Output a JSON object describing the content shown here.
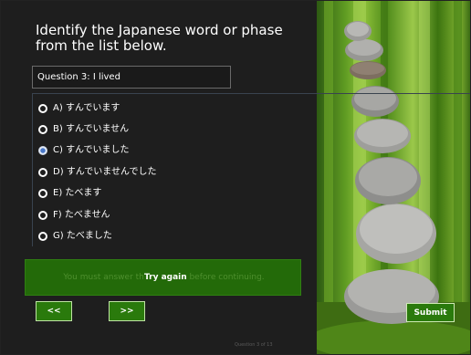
{
  "quiz": {
    "title": "Identify the Japanese  word or phase from the list below.",
    "question_label": "Question 3: I lived",
    "options": [
      {
        "label": "A) すんでいます",
        "selected": false
      },
      {
        "label": "B) すんでいません",
        "selected": false
      },
      {
        "label": "C) すんでいました",
        "selected": true
      },
      {
        "label": "D) すんでいませんでした",
        "selected": false
      },
      {
        "label": "E) たべます",
        "selected": false
      },
      {
        "label": "F) たべません",
        "selected": false
      },
      {
        "label": "G) たべました",
        "selected": false
      }
    ],
    "feedback_before": "You must answer th",
    "feedback_after": "n before continuing.",
    "try_again": "Try again",
    "prev_label": "<<",
    "next_label": ">>",
    "submit_label": "Submit",
    "progress": "Question 3 of 13"
  },
  "colors": {
    "panel_bg": "#1e1e1e",
    "button_green": "#2a7a0c",
    "feedback_green": "#236a09",
    "radio_selected": "#4a78c8"
  },
  "photo": {
    "subject": "stacked-stones-on-moss"
  }
}
